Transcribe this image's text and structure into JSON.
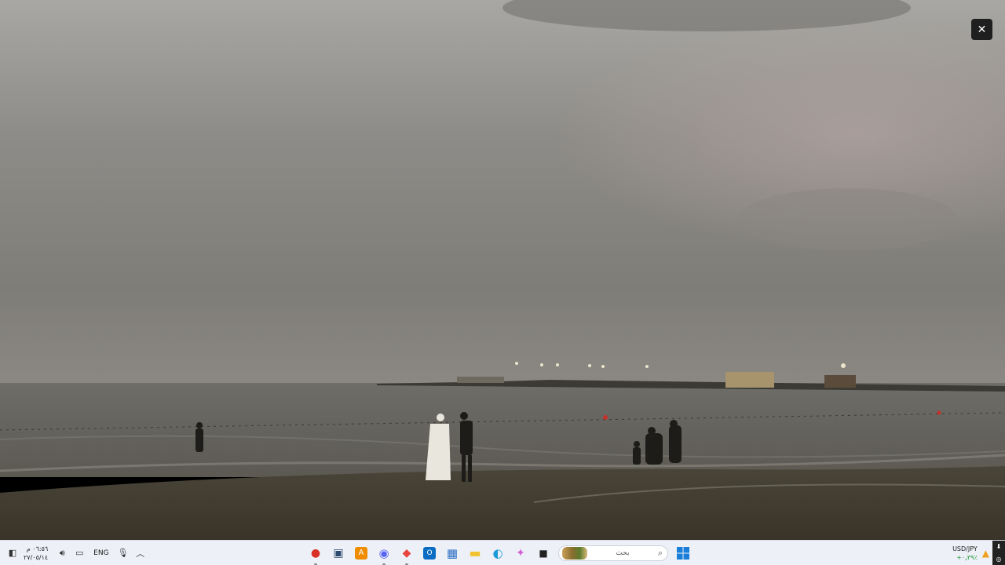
{
  "viewer": {
    "close_label": "✕"
  },
  "taskbar": {
    "clock_time": "٠٦:٥٦ م",
    "clock_date": "٢٧/٠٥/١٤",
    "language": "ENG",
    "search_placeholder": "بحث",
    "apps": [
      {
        "name": "chrome-app",
        "glyph": "●",
        "color": "#d93025"
      },
      {
        "name": "terminal-app",
        "glyph": "▣",
        "color": "#2b4a6f"
      },
      {
        "name": "a-app",
        "glyph": "A",
        "color": "#f08c00"
      },
      {
        "name": "discord-app",
        "glyph": "◉",
        "color": "#5865f2"
      },
      {
        "name": "brave-app",
        "glyph": "◆",
        "color": "#e8453c"
      },
      {
        "name": "outlook-app",
        "glyph": "O",
        "color": "#0b6cc4"
      },
      {
        "name": "store-app",
        "glyph": "▦",
        "color": "#2b6fc4"
      },
      {
        "name": "files-app",
        "glyph": "▬",
        "color": "#f2c230"
      },
      {
        "name": "edge-app",
        "glyph": "◐",
        "color": "#1a9bd7"
      },
      {
        "name": "copilot-app",
        "glyph": "✦",
        "color": "#d15fd6"
      },
      {
        "name": "window-app",
        "glyph": "■",
        "color": "#222222"
      }
    ],
    "ticker_symbol": "USD/JPY",
    "ticker_change": "+٠٫٣٩٪"
  }
}
